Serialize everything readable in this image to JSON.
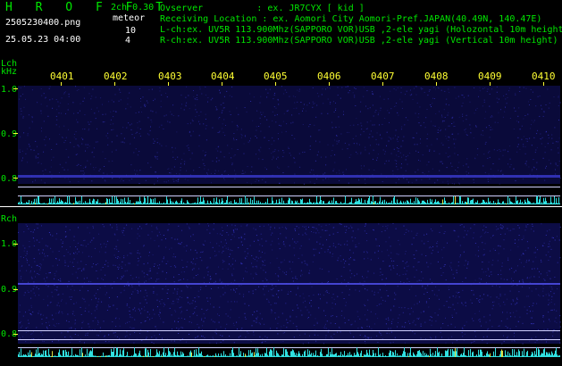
{
  "header": {
    "logo": "H R O F F T",
    "version": "2ch 0.30",
    "filename": "2505230400.png",
    "datetime": "25.05.23 04:00",
    "meteor_label": "meteor",
    "meteor_lch": "10",
    "meteor_rch": "4",
    "observer_line": "Ovserver          : ex. JR7CYX [ kid ]",
    "location_line": "Receiving Location : ex. Aomori City Aomori-Pref.JAPAN(40.49N, 140.47E)",
    "lch_line": "L-ch:ex. UV5R 113.900Mhz(SAPPORO VOR)USB ,2-ele yagi (Holozontal 10m height)",
    "rch_line": "R-ch:ex. UV5R 113.900Mhz(SAPPORO VOR)USB ,2-ele yagi (Vertical 10m height)"
  },
  "lch_panel": {
    "label": "Lch",
    "unit": "kHz",
    "y_ticks": [
      "1.0",
      "0.9",
      "0.8"
    ]
  },
  "rch_panel": {
    "label": "Rch",
    "y_ticks": [
      "1.0",
      "0.9",
      "0.8"
    ]
  },
  "time_labels": [
    "0401",
    "0402",
    "0403",
    "0404",
    "0405",
    "0406",
    "0407",
    "0408",
    "0409",
    "0410"
  ],
  "colors": {
    "background": "#000000",
    "header_green": "#00e600",
    "tick_yellow": "#ffff33",
    "waterfall_blue": "#1a1a8c",
    "strip_cyan": "#30e0e0"
  }
}
